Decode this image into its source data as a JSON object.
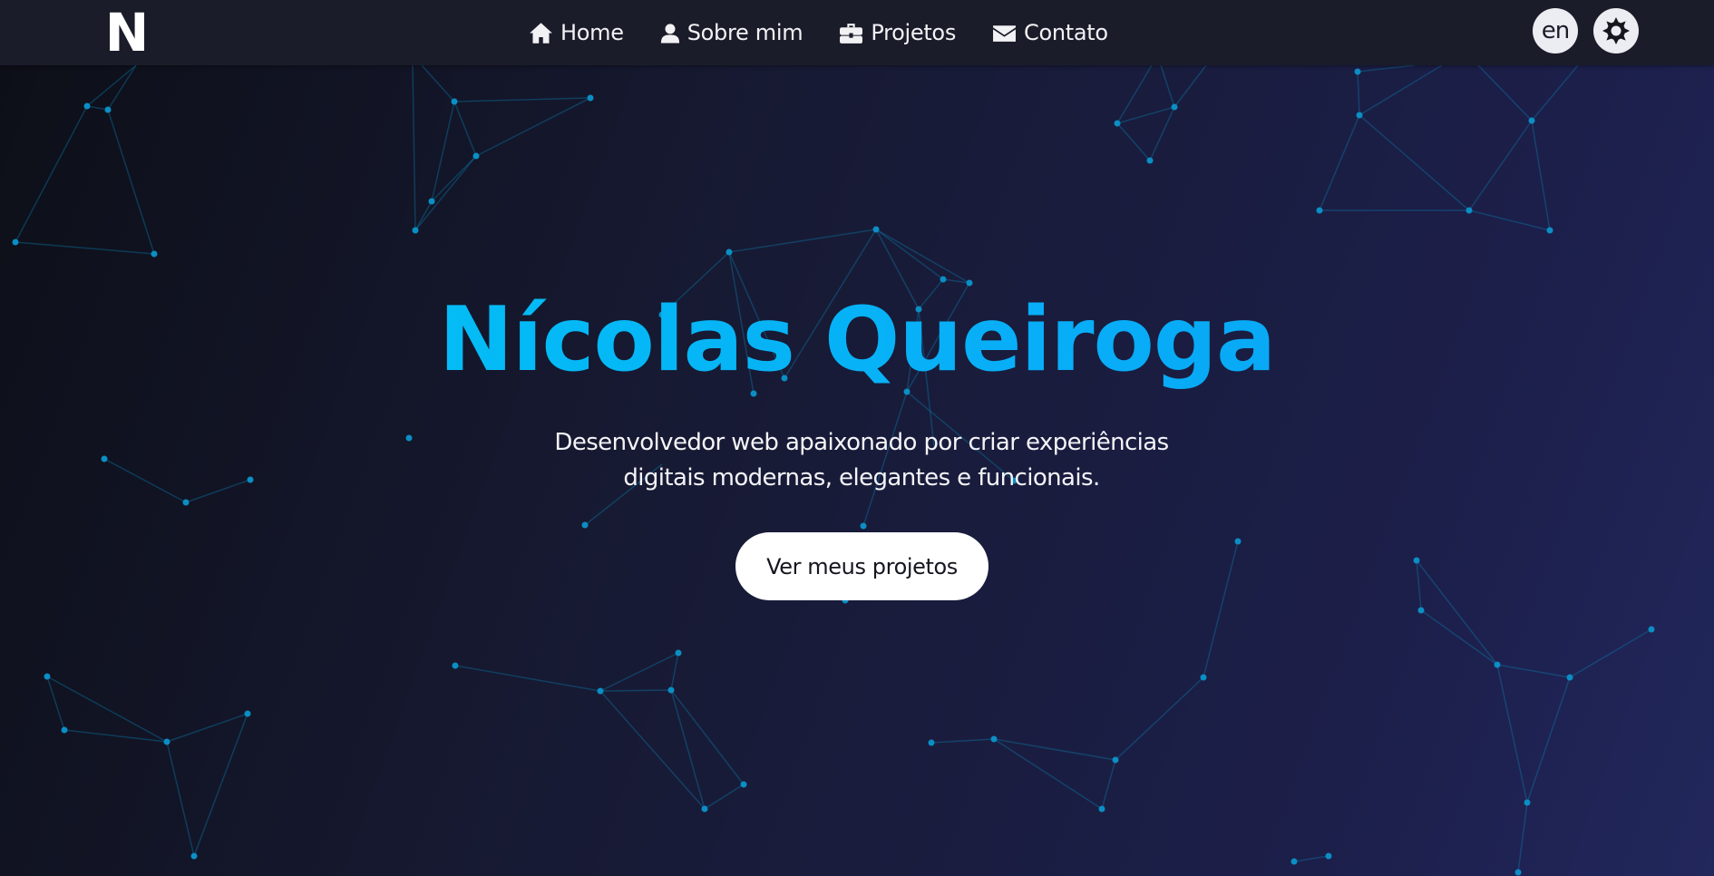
{
  "header": {
    "logo": "N",
    "nav": [
      {
        "label": "Home",
        "icon": "home-icon"
      },
      {
        "label": "Sobre mim",
        "icon": "user-icon"
      },
      {
        "label": "Projetos",
        "icon": "briefcase-icon"
      },
      {
        "label": "Contato",
        "icon": "envelope-icon"
      }
    ],
    "language_label": "en",
    "theme_icon": "sun-icon"
  },
  "hero": {
    "title": "Nícolas Queiroga",
    "subtitle_line1": "Desenvolvedor web apaixonado por criar experiências",
    "subtitle_line2": "digitais modernas, elegantes e funcionais.",
    "cta_label": "Ver meus projetos"
  },
  "colors": {
    "accent": "#00bfff",
    "navbar": "#1b1c2a",
    "node": "#0b8ec4",
    "background_start": "#0d0f18",
    "background_end": "#22275c"
  }
}
